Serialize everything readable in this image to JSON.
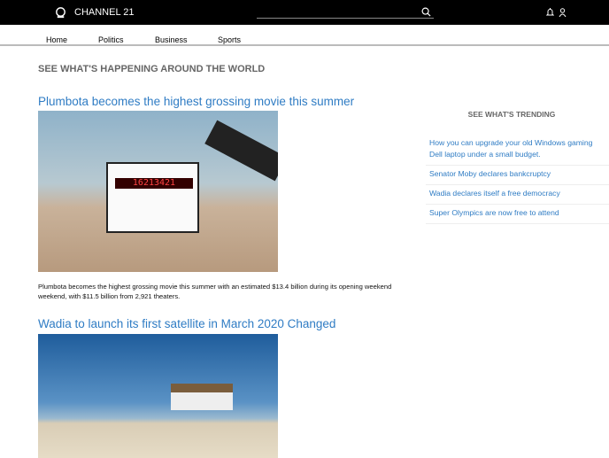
{
  "header": {
    "brand": "CHANNEL 21",
    "search_placeholder": ""
  },
  "nav": [
    "Home",
    "Politics",
    "Business",
    "Sports"
  ],
  "section_title": "SEE WHAT'S HAPPENING AROUND THE WORLD",
  "articles": [
    {
      "title": "Plumbota becomes the highest grossing movie this summer",
      "caption": "Plumbota becomes the highest grossing movie this summer with an estimated $13.4 billion during its opening weekend weekend, with $11.5 billion from 2,921 theaters.",
      "clapper_led": "16213421"
    },
    {
      "title": "Wadia to launch its first satellite in March 2020 Changed"
    }
  ],
  "sidebar": {
    "title": "SEE WHAT'S TRENDING",
    "items": [
      "How you can upgrade your old Windows gaming Dell laptop under a small budget.",
      "Senator Moby declares bankcruptcy",
      "Wadia declares itself a free democracy",
      "Super Olympics are now free to attend"
    ]
  }
}
